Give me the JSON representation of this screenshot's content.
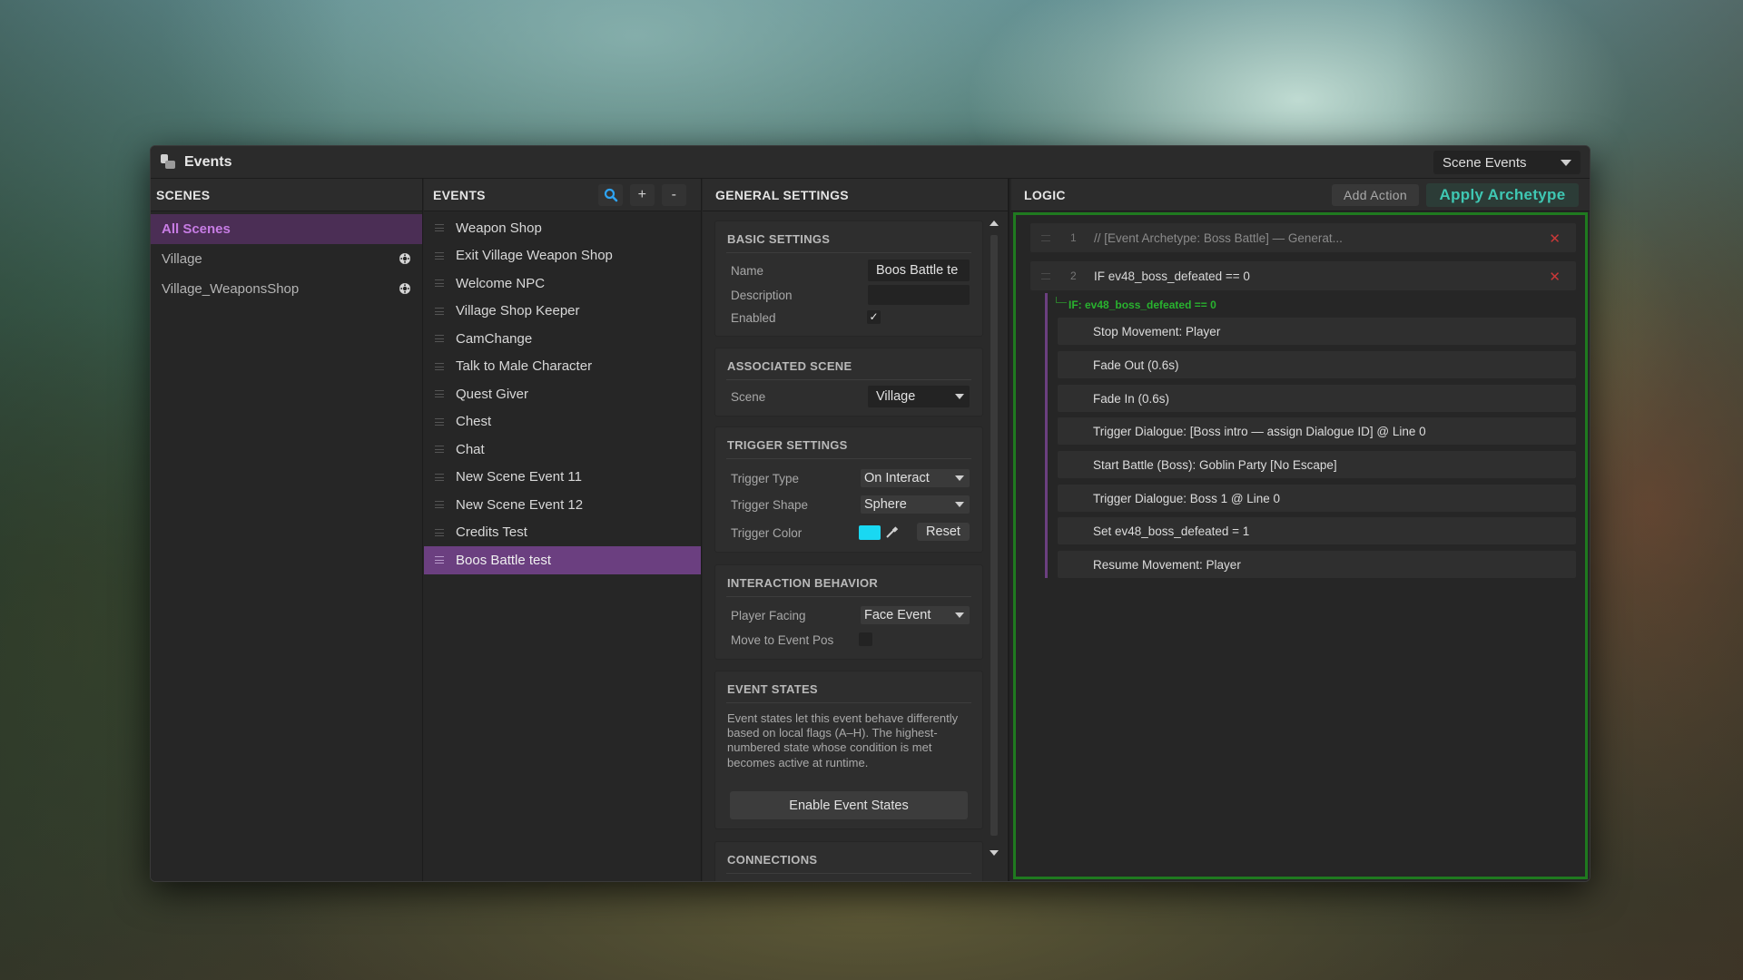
{
  "window": {
    "title": "Events",
    "view_select": "Scene Events"
  },
  "scenes": {
    "header": "SCENES",
    "items": [
      {
        "label": "All Scenes",
        "selected": true,
        "icon": ""
      },
      {
        "label": "Village",
        "selected": false,
        "icon": "gear-icon"
      },
      {
        "label": "Village_WeaponsShop",
        "selected": false,
        "icon": "gear-icon"
      }
    ]
  },
  "events": {
    "header": "EVENTS",
    "search_icon": "search-icon",
    "add_label": "+",
    "remove_label": "-",
    "items": [
      "Weapon Shop",
      "Exit Village Weapon Shop",
      "Welcome NPC",
      "Village Shop Keeper",
      "CamChange",
      "Talk to Male Character",
      "Quest Giver",
      "Chest",
      "Chat",
      "New Scene Event 11",
      "New Scene Event 12",
      "Credits Test",
      "Boos Battle test"
    ],
    "selected_index": 12
  },
  "general": {
    "header": "GENERAL SETTINGS",
    "basic": {
      "title": "BASIC SETTINGS",
      "name_label": "Name",
      "name_value": "Boos Battle te",
      "description_label": "Description",
      "description_value": "",
      "enabled_label": "Enabled",
      "enabled": true,
      "check_mark": "✓"
    },
    "associated": {
      "title": "ASSOCIATED SCENE",
      "scene_label": "Scene",
      "scene_value": "Village"
    },
    "trigger": {
      "title": "TRIGGER SETTINGS",
      "type_label": "Trigger Type",
      "type_value": "On Interact",
      "shape_label": "Trigger Shape",
      "shape_value": "Sphere",
      "color_label": "Trigger Color",
      "color_value": "#19d8f2",
      "reset_label": "Reset"
    },
    "interaction": {
      "title": "INTERACTION BEHAVIOR",
      "facing_label": "Player Facing",
      "facing_value": "Face Event",
      "move_label": "Move to Event Pos",
      "move_checked": false
    },
    "states": {
      "title": "EVENT STATES",
      "description": "Event states let this event behave differently based on local flags (A–H). The highest-numbered state whose condition is met becomes active at runtime.",
      "button_label": "Enable Event States"
    },
    "connections": {
      "title": "CONNECTIONS"
    }
  },
  "logic": {
    "header": "LOGIC",
    "add_action_label": "Add Action",
    "apply_archetype_label": "Apply Archetype",
    "frame_color": "#1f7a1f",
    "rows": [
      {
        "num": "1",
        "text": "// [Event Archetype: Boss Battle] — Generat..."
      },
      {
        "num": "2",
        "text": "IF ev48_boss_defeated == 0"
      }
    ],
    "branch_label": "IF: ev48_boss_defeated == 0",
    "sub_actions": [
      "Stop Movement: Player",
      "Fade Out (0.6s)",
      "Fade In (0.6s)",
      "Trigger Dialogue: [Boss intro — assign Dialogue ID] @ Line 0",
      "Start Battle (Boss): Goblin Party [No Escape]",
      "Trigger Dialogue: Boss 1 @ Line 0",
      "Set ev48_boss_defeated = 1",
      "Resume Movement: Player"
    ],
    "delete_glyph": "✕"
  },
  "colors": {
    "accent_purple": "#6b3f80",
    "selected_scene_text": "#c77ce4",
    "apply_text": "#3fc7b3",
    "delete_red": "#c93838"
  }
}
